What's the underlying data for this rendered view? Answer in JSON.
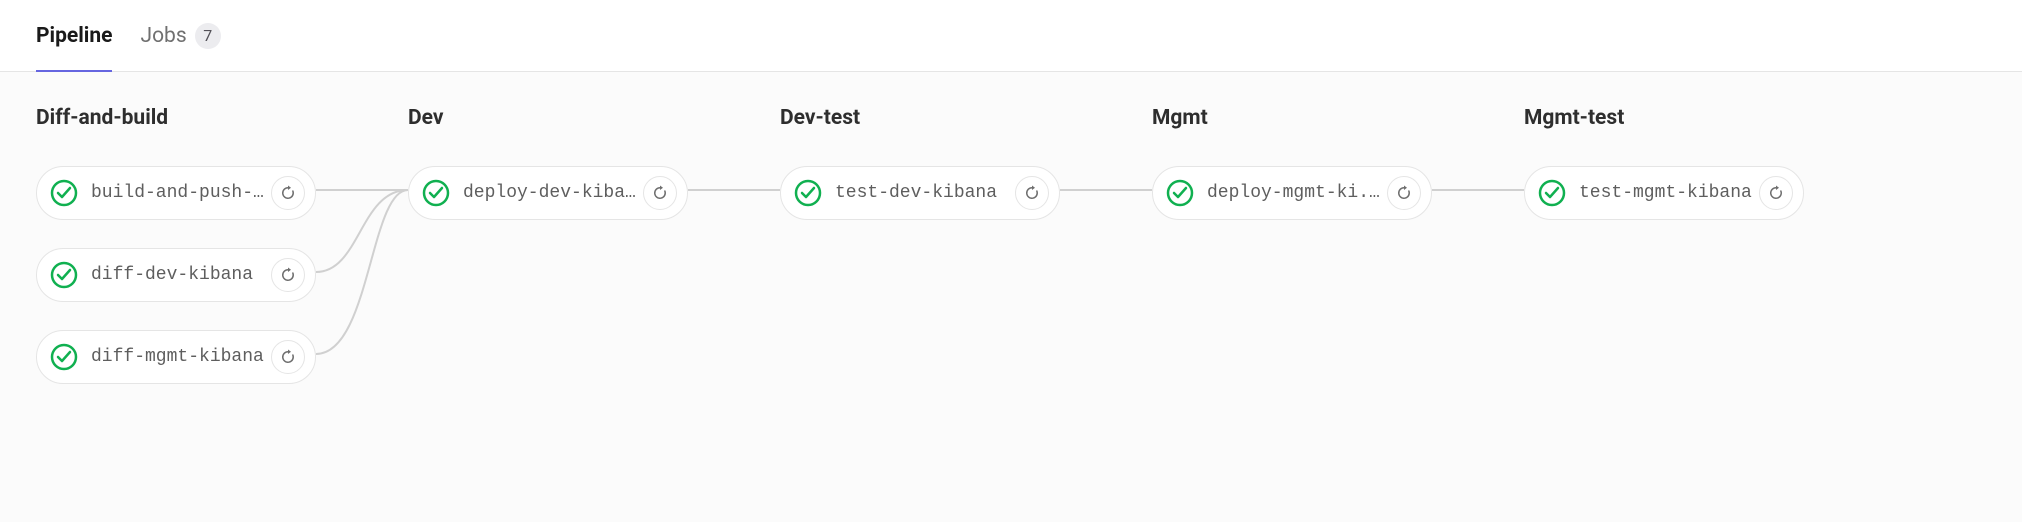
{
  "tabs": {
    "pipeline": "Pipeline",
    "jobs": "Jobs",
    "jobs_count": "7"
  },
  "stages": [
    {
      "title": "Diff-and-build",
      "jobs": [
        {
          "name": "build-and-push-..."
        },
        {
          "name": "diff-dev-kibana"
        },
        {
          "name": "diff-mgmt-kibana"
        }
      ]
    },
    {
      "title": "Dev",
      "jobs": [
        {
          "name": "deploy-dev-kibana"
        }
      ]
    },
    {
      "title": "Dev-test",
      "jobs": [
        {
          "name": "test-dev-kibana"
        }
      ]
    },
    {
      "title": "Mgmt",
      "jobs": [
        {
          "name": "deploy-mgmt-ki..."
        }
      ]
    },
    {
      "title": "Mgmt-test",
      "jobs": [
        {
          "name": "test-mgmt-kibana"
        }
      ]
    }
  ]
}
